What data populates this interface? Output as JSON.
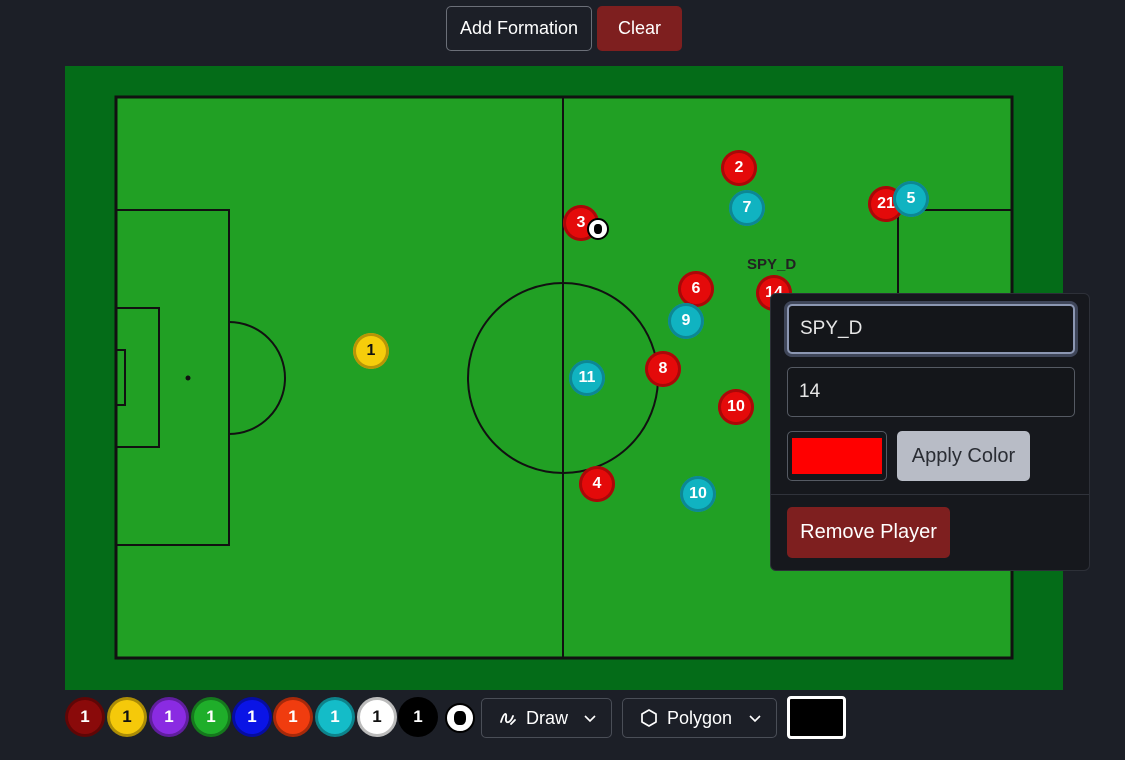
{
  "toolbar": {
    "add_formation_label": "Add Formation",
    "clear_label": "Clear"
  },
  "players": [
    {
      "number": "1",
      "team": "yellow"
    },
    {
      "number": "3",
      "team": "red"
    },
    {
      "number": "2",
      "team": "red"
    },
    {
      "number": "7",
      "team": "cyan"
    },
    {
      "number": "21",
      "team": "red"
    },
    {
      "number": "5",
      "team": "cyan"
    },
    {
      "number": "6",
      "team": "red"
    },
    {
      "number": "14",
      "team": "red",
      "name": "SPY_D"
    },
    {
      "number": "9",
      "team": "cyan"
    },
    {
      "number": "11",
      "team": "cyan"
    },
    {
      "number": "8",
      "team": "red"
    },
    {
      "number": "10",
      "team": "red"
    },
    {
      "number": "4",
      "team": "red"
    },
    {
      "number": "10",
      "team": "cyan"
    }
  ],
  "popup": {
    "name_value": "SPY_D",
    "number_value": "14",
    "color": "#ff0000",
    "apply_label": "Apply Color",
    "remove_label": "Remove Player"
  },
  "palette": [
    {
      "label": "1",
      "color": "#8a0a0a"
    },
    {
      "label": "1",
      "color": "#f5c90a"
    },
    {
      "label": "1",
      "color": "#8a2be2"
    },
    {
      "label": "1",
      "color": "#1fae2a"
    },
    {
      "label": "1",
      "color": "#0a14e6"
    },
    {
      "label": "1",
      "color": "#f03c0f"
    },
    {
      "label": "1",
      "color": "#14bcc8"
    },
    {
      "label": "1",
      "color": "#ffffff"
    },
    {
      "label": "1",
      "color": "#000000"
    }
  ],
  "draw_dropdown": {
    "label": "Draw",
    "icon": "draw-icon"
  },
  "shape_dropdown": {
    "label": "Polygon",
    "icon": "hexagon-icon"
  },
  "stroke_color": "#000000",
  "colors": {
    "pitch": "#21a024",
    "pitch_border": "#046c18",
    "team_red": "#e40a0a",
    "team_cyan": "#10b3c1",
    "background": "#1c1f27"
  }
}
